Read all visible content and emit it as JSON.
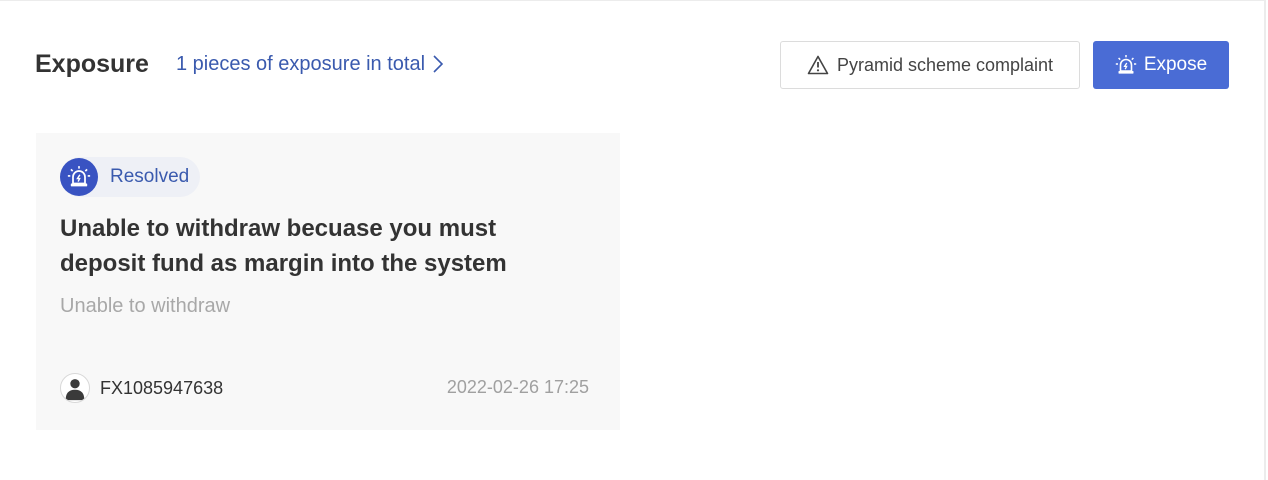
{
  "header": {
    "title": "Exposure",
    "total_link": "1 pieces of exposure in total"
  },
  "actions": {
    "complaint_label": "Pyramid scheme complaint",
    "expose_label": "Expose"
  },
  "cards": [
    {
      "status": "Resolved",
      "title": "Unable to withdraw becuase you must deposit fund as margin into the system",
      "subtitle": "Unable to withdraw",
      "user": "FX1085947638",
      "timestamp": "2022-02-26 17:25"
    }
  ],
  "colors": {
    "accent": "#4a6cd5",
    "link": "#3a5aae",
    "badge": "#3953c2"
  },
  "icons": {
    "chevron": "chevron-right-icon",
    "warning": "warning-triangle-icon",
    "alarm": "alarm-siren-icon",
    "avatar": "user-avatar-icon"
  }
}
